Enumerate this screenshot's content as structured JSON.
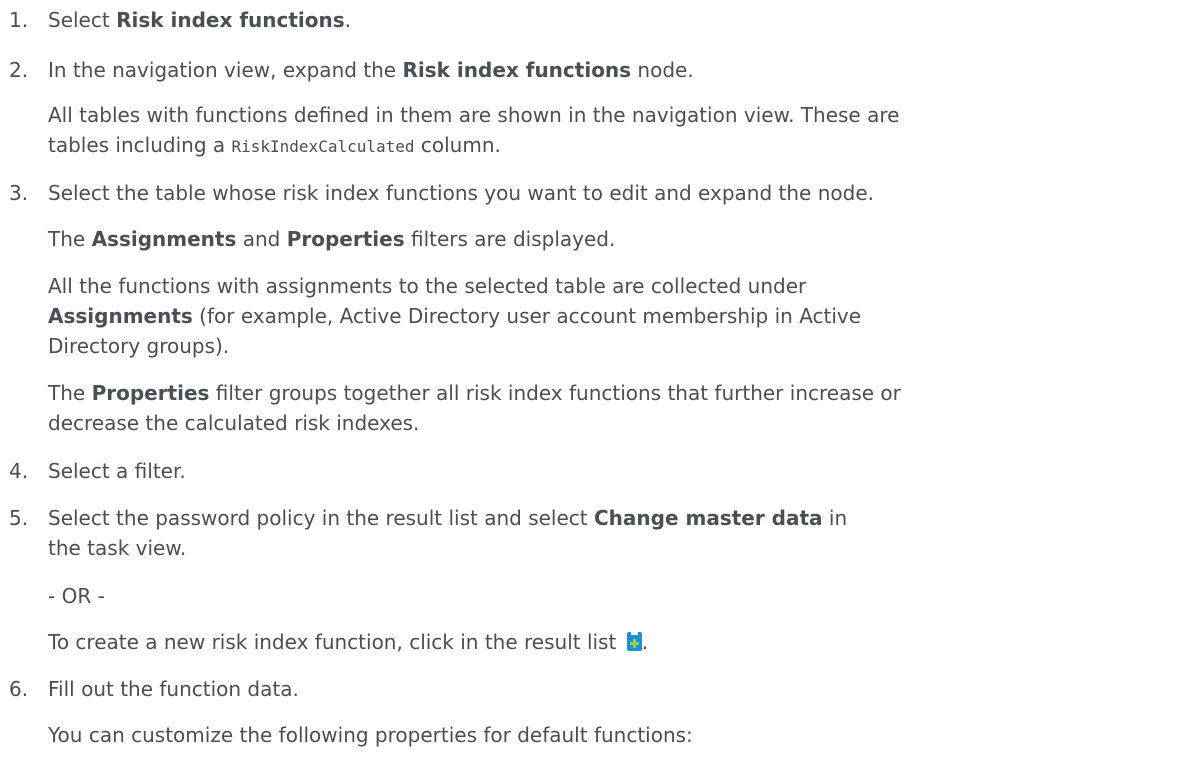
{
  "steps": [
    {
      "num": "1.",
      "pre": "Select ",
      "bold": "Risk index functions",
      "post": "."
    },
    {
      "num": "2.",
      "pre": "In the navigation view, expand the ",
      "bold": "Risk index functions",
      "post": " node."
    },
    {
      "num": "3.",
      "text": "Select the table whose risk index functions you want to edit and expand the node."
    },
    {
      "num": "4.",
      "text": "Select a filter."
    },
    {
      "num": "5.",
      "line1_pre": "Select the password policy in the result list and select ",
      "line1_bold": "Change master data",
      "line1_post": " in",
      "line2": "the task view."
    },
    {
      "num": "6.",
      "text": "Fill out the function data."
    }
  ],
  "step2_para": {
    "line1": "All tables with functions defined in them are shown in the navigation view. These are",
    "line2_pre": "tables including a ",
    "line2_code": "RiskIndexCalculated",
    "line2_post": " column."
  },
  "step3_para1": {
    "pre": "The ",
    "bold1": "Assignments",
    "mid": " and ",
    "bold2": "Properties",
    "post": " filters are displayed."
  },
  "step3_para2": {
    "line1": "All the functions with assignments to the selected table are collected under",
    "line2_bold": "Assignments",
    "line2_post": " (for example, Active Directory user account membership in Active",
    "line3": "Directory groups)."
  },
  "step3_para3": {
    "line1_pre": "The ",
    "line1_bold": "Properties",
    "line1_post": " filter groups together all risk index functions that further increase or",
    "line2": "decrease the calculated risk indexes."
  },
  "step5_or": "- OR -",
  "step5_alt": "To create a new risk index function, click in the result list ",
  "step5_alt_end": ".",
  "step6_para": "You can customize the following properties for default functions:",
  "icons": {
    "add": "add-new-icon"
  }
}
